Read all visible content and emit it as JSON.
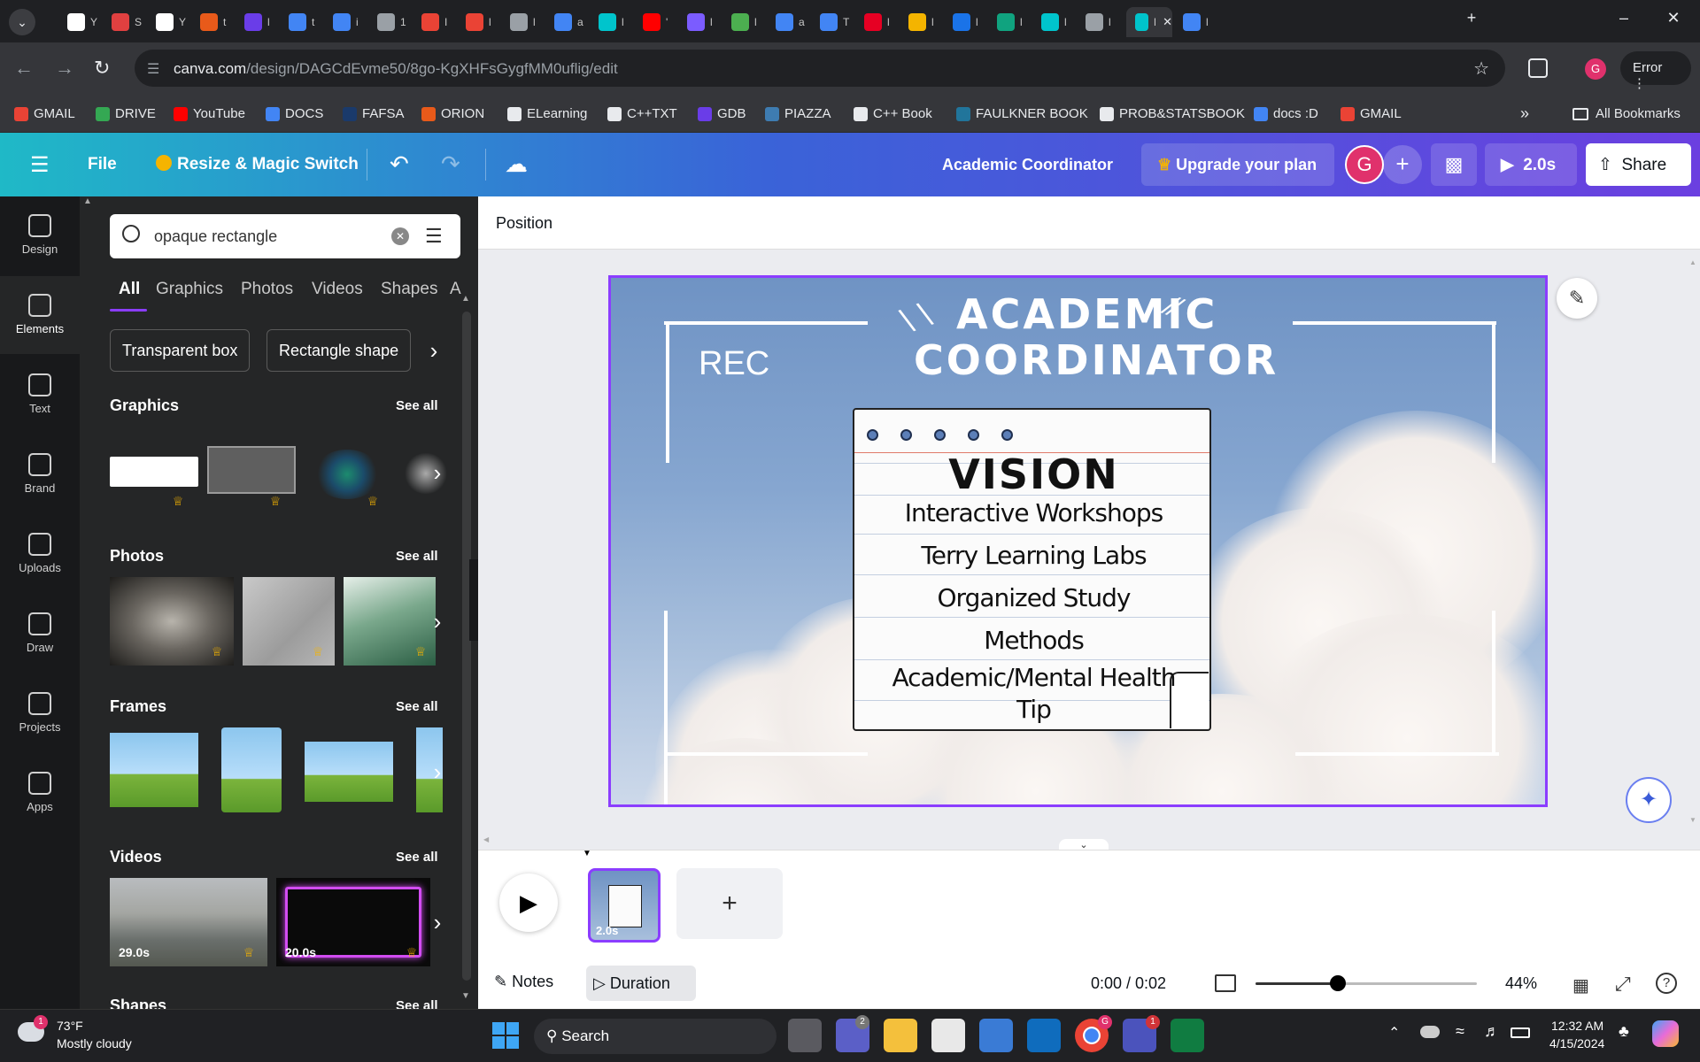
{
  "browser": {
    "url_host": "canva.com",
    "url_path": "/design/DAGCdEvme50/8go-KgXHFsGygfMM0uflig/edit",
    "profile_label": "Error",
    "tab_title_fragments": [
      "Y",
      "S",
      "Y",
      "t",
      "l",
      "t",
      "i",
      "1",
      "I",
      "l",
      "l",
      "a",
      "l",
      "'",
      "l",
      "l",
      "a",
      "T",
      "l",
      "l",
      "l",
      "l",
      "l",
      "l",
      "l",
      "l",
      "a",
      "l"
    ],
    "tab_colors": [
      "#ffffff",
      "#e04040",
      "#ffffff",
      "#e85a1a",
      "#6a3de8",
      "#4285f4",
      "#4285f4",
      "#9aa0a6",
      "#ea4335",
      "#ea4335",
      "#9aa0a6",
      "#4285f4",
      "#00c4cc",
      "#ff0000",
      "#7b5cff",
      "#4caf50",
      "#4285f4",
      "#4285f4",
      "#e60023",
      "#f4b400",
      "#1a73e8",
      "#10a37f",
      "#00c4cc",
      "#9aa0a6",
      "#00c4cc",
      "#4285f4"
    ]
  },
  "bookmarks": [
    {
      "label": "GMAIL",
      "color": "#ea4335"
    },
    {
      "label": "DRIVE",
      "color": "#34a853"
    },
    {
      "label": "YouTube",
      "color": "#ff0000"
    },
    {
      "label": "DOCS",
      "color": "#4285f4"
    },
    {
      "label": "FAFSA",
      "color": "#1a3a6b"
    },
    {
      "label": "ORION",
      "color": "#e85a1a"
    },
    {
      "label": "ELearning",
      "color": "#e8eaed"
    },
    {
      "label": "C++TXT",
      "color": "#e8eaed"
    },
    {
      "label": "GDB",
      "color": "#6a3de8"
    },
    {
      "label": "PIAZZA",
      "color": "#3e7cb1"
    },
    {
      "label": "C++ Book",
      "color": "#e8eaed"
    },
    {
      "label": "FAULKNER BOOK",
      "color": "#21759b"
    },
    {
      "label": "PROB&STATSBOOK",
      "color": "#e8eaed"
    },
    {
      "label": "docs :D",
      "color": "#4285f4"
    },
    {
      "label": "GMAIL",
      "color": "#ea4335"
    }
  ],
  "all_bookmarks_label": "All Bookmarks",
  "canva_header": {
    "file": "File",
    "resize": "Resize & Magic Switch",
    "design_title": "Academic Coordinator",
    "upgrade": "Upgrade your plan",
    "avatar_letter": "G",
    "play_duration": "2.0s",
    "share": "Share"
  },
  "rail": [
    {
      "label": "Design"
    },
    {
      "label": "Elements"
    },
    {
      "label": "Text"
    },
    {
      "label": "Brand"
    },
    {
      "label": "Uploads"
    },
    {
      "label": "Draw"
    },
    {
      "label": "Projects"
    },
    {
      "label": "Apps"
    }
  ],
  "panel": {
    "search_value": "opaque rectangle",
    "tabs": [
      "All",
      "Graphics",
      "Photos",
      "Videos",
      "Shapes",
      "A"
    ],
    "chips": [
      "Transparent box",
      "Rectangle shape"
    ],
    "sections": {
      "graphics": "Graphics",
      "photos": "Photos",
      "frames": "Frames",
      "videos": "Videos",
      "shapes": "Shapes"
    },
    "see_all": "See all",
    "video_durations": [
      "29.0s",
      "20.0s"
    ]
  },
  "editor": {
    "position_label": "Position"
  },
  "slide": {
    "title_line1": "ACADEMIC",
    "title_line2": "COORDINATOR",
    "rec": "REC",
    "note_heading": "VISION",
    "note_lines": [
      "Interactive Workshops",
      "Terry Learning Labs",
      "Organized Study",
      "Methods",
      "Academic/Mental Health",
      "Tip"
    ]
  },
  "timeline": {
    "thumb_duration": "2.0s",
    "notes": "Notes",
    "duration": "Duration",
    "time": "0:00 / 0:02",
    "zoom": "44%",
    "zoom_level": 0.37
  },
  "taskbar": {
    "weather_temp": "73°F",
    "weather_desc": "Mostly cloudy",
    "weather_badge": "1",
    "search": "Search",
    "time": "12:32 AM",
    "date": "4/15/2024",
    "teams_badge": "2",
    "chrome_badge": "G",
    "app_badge": "1"
  }
}
